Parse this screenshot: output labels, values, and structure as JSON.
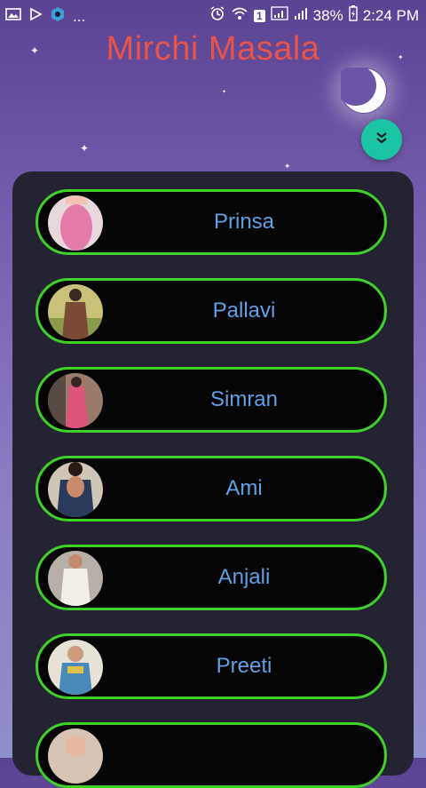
{
  "status_bar": {
    "battery": "38%",
    "time": "2:24 PM",
    "notification_dots": "...",
    "sim_badge": "1"
  },
  "app": {
    "title": "Mirchi Masala",
    "title_color": "#e8534a",
    "accent": "#1bc4a4",
    "item_border": "#3fd12a",
    "item_text_color": "#5fa0e6"
  },
  "icons": {
    "moon": "crescent-moon-icon",
    "scroll": "double-chevron-down-icon"
  },
  "items": [
    {
      "label": "Prinsa"
    },
    {
      "label": "Pallavi"
    },
    {
      "label": "Simran"
    },
    {
      "label": "Ami"
    },
    {
      "label": "Anjali"
    },
    {
      "label": "Preeti"
    },
    {
      "label": ""
    }
  ]
}
